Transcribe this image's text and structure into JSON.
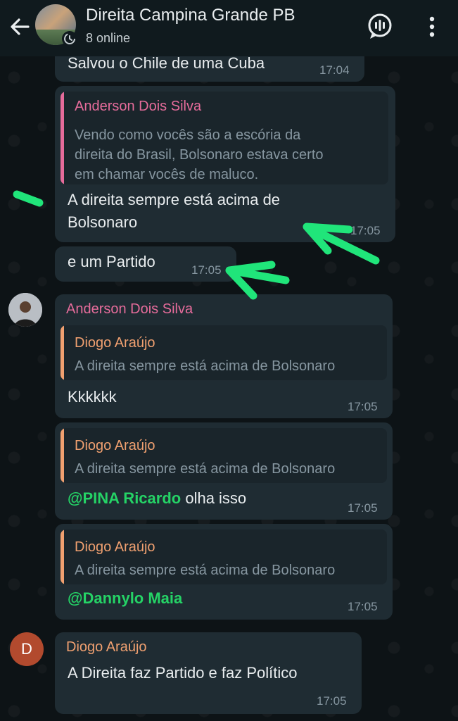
{
  "header": {
    "title": "Direita Campina Grande PB",
    "subtitle": "8 online"
  },
  "colors": {
    "accent_pink": "#e66c9b",
    "accent_orange": "#f0a070",
    "mention_green": "#25d366",
    "annotation_green": "#20e57a"
  },
  "messages": [
    {
      "text": "Salvou o Chile de uma Cuba",
      "time": "17:04"
    },
    {
      "quote_author": "Anderson Dois Silva",
      "quote_text": [
        "Vendo como vocês são a escória da",
        "direita do Brasil, Bolsonaro estava certo",
        "em chamar vocês de maluco."
      ],
      "text": [
        "A direita sempre está acima de",
        "Bolsonaro"
      ],
      "time": "17:05"
    },
    {
      "text": "e um Partido",
      "time": "17:05"
    },
    {
      "sender": "Anderson Dois Silva",
      "quote_author": "Diogo Araújo",
      "quote_text": "A direita sempre está acima de Bolsonaro",
      "text": "Kkkkkk",
      "time": "17:05"
    },
    {
      "quote_author": "Diogo Araújo",
      "quote_text": "A direita sempre está acima de Bolsonaro",
      "mention": "@PINA Ricardo",
      "text": " olha isso",
      "time": "17:05"
    },
    {
      "quote_author": "Diogo Araújo",
      "quote_text": "A direita sempre está acima de Bolsonaro",
      "mention": "@Dannylo Maia",
      "time": "17:05"
    },
    {
      "sender": "Diogo Araújo",
      "avatar_letter": "D",
      "text": "A Direita faz Partido e faz Político",
      "time": "17:05"
    }
  ]
}
